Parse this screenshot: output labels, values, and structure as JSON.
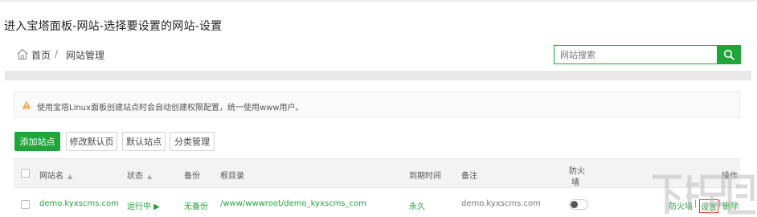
{
  "caption": "进入宝塔面板-网站-选择要设置的网站-设置",
  "breadcrumb": {
    "home": "首页",
    "separator": "/",
    "current": "网站管理"
  },
  "search": {
    "placeholder": "网站搜索"
  },
  "notice": {
    "text": "使用宝塔Linux面板创建站点时会自动创建权限配置，统一使用www用户。"
  },
  "toolbar": {
    "add_site": "添加站点",
    "edit_default_page": "修改默认页",
    "default_site": "默认站点",
    "category_manage": "分类管理"
  },
  "table": {
    "headers": {
      "site_name": "网站名",
      "status": "状态",
      "backup": "备份",
      "root_dir": "根目录",
      "expire": "到期时间",
      "remark": "备注",
      "firewall_line1": "防火",
      "firewall_line2": "墙",
      "actions": "操作"
    },
    "rows": [
      {
        "site_name": "demo.kyxscms.com",
        "status": "运行中 ▶",
        "backup": "无备份",
        "root_dir": "/www/wwwroot/demo_kyxscms_com",
        "expire": "永久",
        "remark": "demo.kyxscms.com",
        "firewall": false,
        "actions": [
          "防火墙",
          "设置",
          "删除"
        ]
      }
    ]
  },
  "colors": {
    "accent": "#20a53a",
    "warning": "#f0ad4e"
  },
  "icons": [
    "home-icon",
    "search-icon",
    "warning-icon",
    "sort-up-icon"
  ],
  "watermark": {
    "text": "下载吧"
  }
}
